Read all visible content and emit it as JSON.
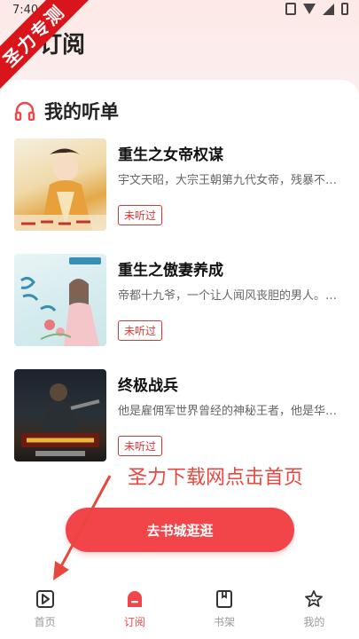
{
  "status_bar": {
    "time": "7:40"
  },
  "ribbon": {
    "text": "圣力专测"
  },
  "header": {
    "title": "订阅"
  },
  "section": {
    "title": "我的听单"
  },
  "books": [
    {
      "title": "重生之女帝权谋",
      "desc": "宇文天昭，大宗王朝第九代女帝，残暴不…",
      "badge": "未听过"
    },
    {
      "title": "重生之傲妻养成",
      "desc": "帝都十九爷，一个让人闻风丧胆的男人。…",
      "badge": "未听过"
    },
    {
      "title": "终极战兵",
      "desc": "他是雇佣军世界曾经的神秘王者，他是华夏…",
      "badge": "未听过"
    }
  ],
  "overlay": {
    "text": "圣力下载网点击首页"
  },
  "cta": {
    "label": "去书城逛逛"
  },
  "tabs": [
    {
      "label": "首页",
      "icon": "play-book-icon"
    },
    {
      "label": "订阅",
      "icon": "subscribe-icon"
    },
    {
      "label": "书架",
      "icon": "bookshelf-icon"
    },
    {
      "label": "我的",
      "icon": "profile-icon"
    }
  ],
  "colors": {
    "accent": "#f2454a",
    "badge": "#e2332e",
    "overlay_text": "#e8473f",
    "ribbon": "#d9151b"
  }
}
